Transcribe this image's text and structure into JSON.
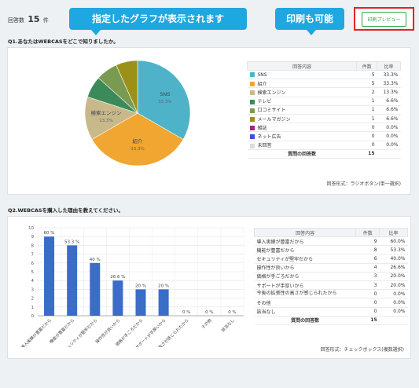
{
  "header": {
    "count_label": "回答数",
    "count_value": "15",
    "count_unit": "件",
    "callout_chart": "指定したグラフが表示されます",
    "callout_print": "印刷も可能",
    "print_preview_button": "印刷プレビュー"
  },
  "colors": {
    "accent_blue": "#1ea7e0",
    "preview_green": "#28a745",
    "highlight_red": "#e32222",
    "bar_blue": "#3a6cc8"
  },
  "q1": {
    "title": "Q1.あなたはWEBCASをどこで知りましたか。",
    "response_type": "回答形式：ラジオボタン(単一選択)",
    "table": {
      "headers": [
        "回答内容",
        "件数",
        "比率"
      ],
      "rows": [
        {
          "label": "SNS",
          "count": "5",
          "ratio": "33.3%",
          "color": "#4eb3c9"
        },
        {
          "label": "紹介",
          "count": "5",
          "ratio": "33.3%",
          "color": "#f0a630"
        },
        {
          "label": "検索エンジン",
          "count": "2",
          "ratio": "13.3%",
          "color": "#c9b98a"
        },
        {
          "label": "テレビ",
          "count": "1",
          "ratio": "6.6%",
          "color": "#3c8a5a"
        },
        {
          "label": "口コミサイト",
          "count": "1",
          "ratio": "6.6%",
          "color": "#7a9a52"
        },
        {
          "label": "メールマガジン",
          "count": "1",
          "ratio": "6.6%",
          "color": "#9c9118"
        },
        {
          "label": "雑誌",
          "count": "0",
          "ratio": "0.0%",
          "color": "#9c2a7c"
        },
        {
          "label": "ネット広告",
          "count": "0",
          "ratio": "0.0%",
          "color": "#3c52d0"
        },
        {
          "label": "未回答",
          "count": "0",
          "ratio": "0.0%",
          "color": "#dcdcdc"
        }
      ],
      "total_label": "質問の回答数",
      "total_value": "15"
    }
  },
  "q2": {
    "title": "Q2.WEBCASを購入した理由を教えてください。",
    "response_type": "回答形式：チェックボックス(複数選択)",
    "table": {
      "headers": [
        "回答内容",
        "件数",
        "比率"
      ],
      "rows": [
        {
          "label": "導入実績が豊富だから",
          "count": "9",
          "ratio": "60.0%"
        },
        {
          "label": "機能が豊富だから",
          "count": "8",
          "ratio": "53.3%"
        },
        {
          "label": "セキュリティが堅牢だから",
          "count": "6",
          "ratio": "40.0%"
        },
        {
          "label": "操作性が良いから",
          "count": "4",
          "ratio": "26.6%"
        },
        {
          "label": "価格が手ごろだから",
          "count": "3",
          "ratio": "20.0%"
        },
        {
          "label": "サポートが手厚いから",
          "count": "3",
          "ratio": "20.0%"
        },
        {
          "label": "今後の拡張性の高さが感じられたから",
          "count": "0",
          "ratio": "0.0%"
        },
        {
          "label": "その他",
          "count": "0",
          "ratio": "0.0%"
        },
        {
          "label": "該当なし",
          "count": "0",
          "ratio": "0.0%"
        }
      ],
      "total_label": "質問の回答数",
      "total_value": "15"
    }
  },
  "chart_data": [
    {
      "type": "pie",
      "categories": [
        "SNS",
        "紹介",
        "検索エンジン",
        "テレビ",
        "口コミサイト",
        "メールマガジン"
      ],
      "values": [
        5,
        5,
        2,
        1,
        1,
        1
      ],
      "slice_labels": [
        {
          "name": "SNS",
          "pct": "33.3%"
        },
        {
          "name": "紹介",
          "pct": "33.3%"
        },
        {
          "name": "検索エンジン",
          "pct": "13.3%"
        }
      ],
      "colors": [
        "#4eb3c9",
        "#f0a630",
        "#c9b98a",
        "#3c8a5a",
        "#7a9a52",
        "#9c9118"
      ]
    },
    {
      "type": "bar",
      "categories": [
        "導入実績が豊富だから",
        "機能が豊富だから",
        "セキュリティが堅牢だから",
        "操作性が良いから",
        "価格が手ごろだから",
        "サポートが手厚いから",
        "今後の拡張性の高さが感じられたから",
        "その他",
        "該当なし"
      ],
      "values": [
        9,
        8,
        6,
        4,
        3,
        3,
        0,
        0,
        0
      ],
      "data_labels": [
        "60 %",
        "53.3 %",
        "40 %",
        "26.6 %",
        "20 %",
        "20 %",
        "0 %",
        "0 %",
        "0 %"
      ],
      "ylim": [
        0,
        10
      ],
      "yticks": [
        0,
        1,
        2,
        3,
        4,
        5,
        6,
        7,
        8,
        9,
        10
      ],
      "grid": true,
      "color": "#3a6cc8"
    }
  ]
}
